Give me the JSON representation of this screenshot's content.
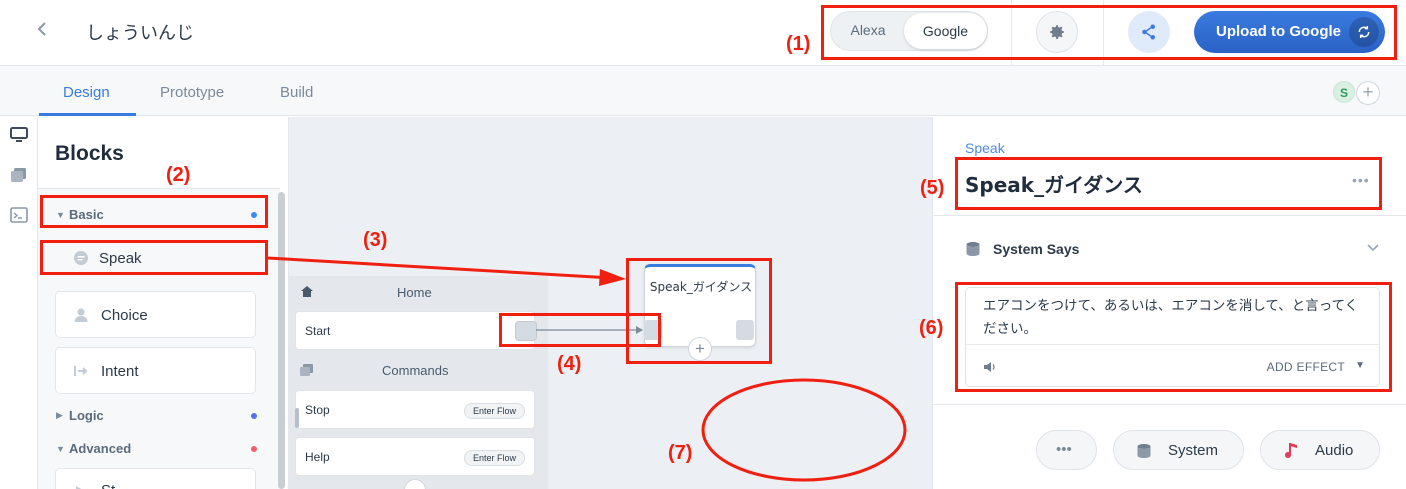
{
  "header": {
    "back_icon": "chevron-left-icon",
    "project_title": "しょういんじ",
    "platforms": {
      "alexa": "Alexa",
      "google": "Google",
      "selected": "Google"
    },
    "upload_label": "Upload to Google",
    "accent_color": "#3a7be0"
  },
  "tabs": [
    {
      "label": "Design",
      "active": true
    },
    {
      "label": "Prototype",
      "active": false
    },
    {
      "label": "Build",
      "active": false
    }
  ],
  "collaborator": {
    "initial": "S",
    "add": "+"
  },
  "blocks_panel": {
    "title": "Blocks",
    "sections": [
      {
        "label": "Basic",
        "expanded": true,
        "dot_color": "#3a8df0"
      },
      {
        "label": "Logic",
        "expanded": false,
        "dot_color": "#5a6ff0"
      },
      {
        "label": "Advanced",
        "expanded": true,
        "dot_color": "#f0606a"
      }
    ],
    "basic_items": [
      {
        "label": "Speak",
        "icon": "speak-icon"
      },
      {
        "label": "Choice",
        "icon": "user-icon"
      },
      {
        "label": "Intent",
        "icon": "arrow-in-icon"
      }
    ],
    "advanced_item_partial": "St"
  },
  "canvas": {
    "home_label": "Home",
    "start_label": "Start",
    "commands_label": "Commands",
    "commands": [
      {
        "label": "Stop",
        "action": "Enter Flow"
      },
      {
        "label": "Help",
        "action": "Enter Flow"
      }
    ],
    "node_title": "Speak_ガイダンス",
    "node_add": "+"
  },
  "editor": {
    "block_type": "Speak",
    "block_name": "Speak_ガイダンス",
    "more": "•••",
    "says_label": "System Says",
    "speech_text": "エアコンをつけて、あるいは、エアコンを消して、と言ってください。",
    "add_effect": "ADD EFFECT",
    "buttons": {
      "more": "•••",
      "system": "System",
      "audio": "Audio"
    }
  },
  "annotations": [
    "(1)",
    "(2)",
    "(3)",
    "(4)",
    "(5)",
    "(6)",
    "(7)"
  ],
  "annotation_color": "#f01f0f"
}
